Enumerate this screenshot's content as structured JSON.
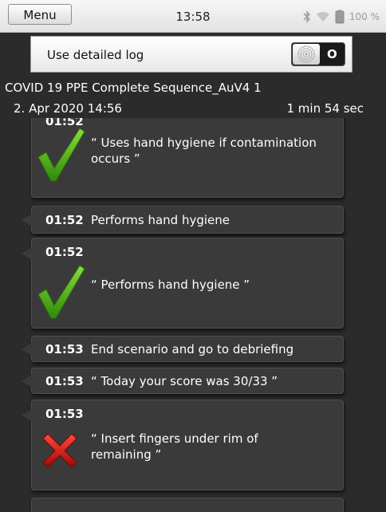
{
  "status_bar": {
    "menu_label": "Menu",
    "time": "13:58",
    "battery_text": "100 %",
    "icons": [
      "bluetooth-icon",
      "wifi-icon",
      "battery-icon"
    ]
  },
  "toggle": {
    "label": "Use detailed log",
    "state": "O"
  },
  "session": {
    "title": "COVID 19 PPE Complete Sequence_AuV4 1",
    "date": "2. Apr 2020 14:56",
    "duration": "1 min 54 sec"
  },
  "log": {
    "entries": [
      {
        "time": "01:52",
        "text_line1": "“ Uses hand hygiene if contamination",
        "text_line2": "occurs ”",
        "icon": "checkmark-icon"
      },
      {
        "time": "01:52",
        "text": "Performs hand hygiene"
      },
      {
        "time": "01:52",
        "text": "“ Performs hand hygiene ”",
        "icon": "checkmark-icon"
      },
      {
        "time": "01:53",
        "text": "End scenario and go to debriefing"
      },
      {
        "time": "01:53",
        "text": "“ Today your score was 30/33 ”"
      },
      {
        "time": "01:53",
        "text_line1": "“ Insert fingers under rim of",
        "text_line2": "remaining ”",
        "icon": "cross-icon"
      }
    ]
  },
  "colors": {
    "background": "#2b2b2b",
    "entry": "#3a3a3a",
    "check": "#4caf1a",
    "cross": "#c81010"
  }
}
